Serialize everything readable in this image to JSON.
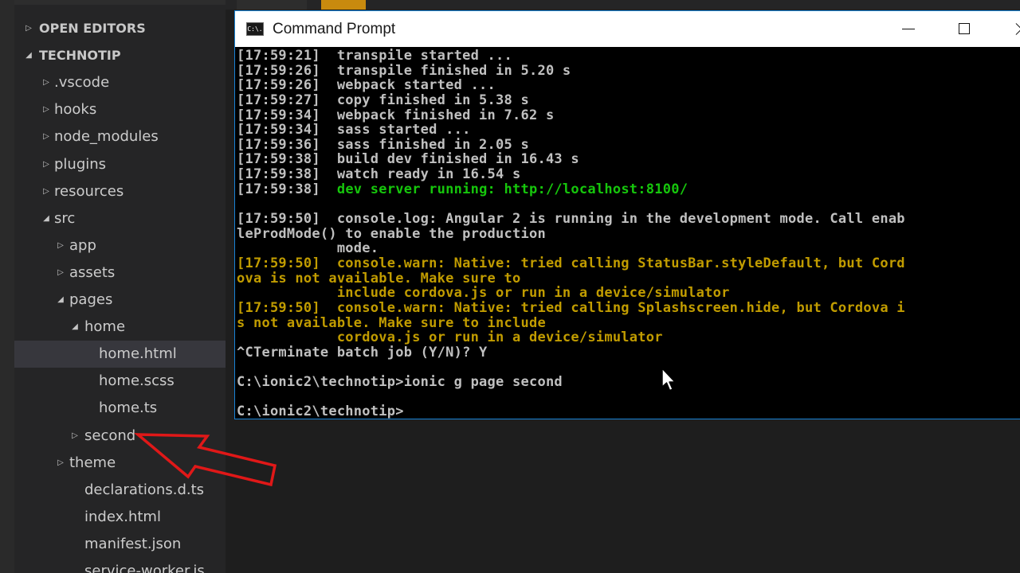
{
  "explorer": {
    "items": [
      {
        "label": "OPEN EDITORS",
        "twisty": "closed",
        "level": 0,
        "header": true
      },
      {
        "label": "TECHNOTIP",
        "twisty": "open",
        "level": 0,
        "header": true
      },
      {
        "label": ".vscode",
        "twisty": "closed",
        "level": 1
      },
      {
        "label": "hooks",
        "twisty": "closed",
        "level": 1
      },
      {
        "label": "node_modules",
        "twisty": "closed",
        "level": 1
      },
      {
        "label": "plugins",
        "twisty": "closed",
        "level": 1
      },
      {
        "label": "resources",
        "twisty": "closed",
        "level": 1
      },
      {
        "label": "src",
        "twisty": "open",
        "level": 1
      },
      {
        "label": "app",
        "twisty": "closed",
        "level": 2
      },
      {
        "label": "assets",
        "twisty": "closed",
        "level": 2
      },
      {
        "label": "pages",
        "twisty": "open",
        "level": 2
      },
      {
        "label": "home",
        "twisty": "open",
        "level": 3
      },
      {
        "label": "home.html",
        "twisty": "none",
        "level": 4,
        "selected": true
      },
      {
        "label": "home.scss",
        "twisty": "none",
        "level": 4
      },
      {
        "label": "home.ts",
        "twisty": "none",
        "level": 4
      },
      {
        "label": "second",
        "twisty": "closed",
        "level": 3
      },
      {
        "label": "theme",
        "twisty": "closed",
        "level": 2
      },
      {
        "label": "declarations.d.ts",
        "twisty": "none",
        "level": 3
      },
      {
        "label": "index.html",
        "twisty": "none",
        "level": 3
      },
      {
        "label": "manifest.json",
        "twisty": "none",
        "level": 3
      },
      {
        "label": "service-worker.js",
        "twisty": "none",
        "level": 3
      }
    ]
  },
  "cmd": {
    "title": "Command Prompt",
    "icon_text": "C:\\.",
    "lines": [
      {
        "t": "[17:59:21]  transpile started ...",
        "c": "w"
      },
      {
        "t": "[17:59:26]  transpile finished in 5.20 s",
        "c": "w"
      },
      {
        "t": "[17:59:26]  webpack started ...",
        "c": "w"
      },
      {
        "t": "[17:59:27]  copy finished in 5.38 s",
        "c": "w"
      },
      {
        "t": "[17:59:34]  webpack finished in 7.62 s",
        "c": "w"
      },
      {
        "t": "[17:59:34]  sass started ...",
        "c": "w"
      },
      {
        "t": "[17:59:36]  sass finished in 2.05 s",
        "c": "w"
      },
      {
        "t": "[17:59:38]  build dev finished in 16.43 s",
        "c": "w"
      },
      {
        "t": "[17:59:38]  watch ready in 16.54 s",
        "c": "w"
      },
      {
        "t": "[17:59:38]  ",
        "c": "w",
        "g": "dev server running: http://localhost:8100/"
      },
      {
        "t": "",
        "c": "w"
      },
      {
        "t": "[17:59:50]  console.log: Angular 2 is running in the development mode. Call enab",
        "c": "w"
      },
      {
        "t": "leProdMode() to enable the production",
        "c": "w"
      },
      {
        "t": "            mode.",
        "c": "w"
      },
      {
        "t": "[17:59:50]  console.warn: Native: tried calling StatusBar.styleDefault, but Cord",
        "c": "y"
      },
      {
        "t": "ova is not available. Make sure to",
        "c": "y"
      },
      {
        "t": "            include cordova.js or run in a device/simulator",
        "c": "y"
      },
      {
        "t": "[17:59:50]  console.warn: Native: tried calling Splashscreen.hide, but Cordova i",
        "c": "y"
      },
      {
        "t": "s not available. Make sure to include",
        "c": "y"
      },
      {
        "t": "            cordova.js or run in a device/simulator",
        "c": "y"
      },
      {
        "t": "^CTerminate batch job (Y/N)? Y",
        "c": "w"
      },
      {
        "t": "",
        "c": "w"
      },
      {
        "t": "C:\\ionic2\\technotip>ionic g page second",
        "c": "w"
      },
      {
        "t": "",
        "c": "w"
      },
      {
        "t": "C:\\ionic2\\technotip>",
        "c": "w"
      }
    ]
  },
  "colors": {
    "console_text": "#c0c0c0",
    "console_green": "#16c60c",
    "console_yellow": "#c19c00",
    "annotation_red": "#e01818",
    "selection": "#37373d"
  },
  "icons": {
    "pointer": "mouse-pointer-icon",
    "annotation": "red-arrow-annotation"
  }
}
